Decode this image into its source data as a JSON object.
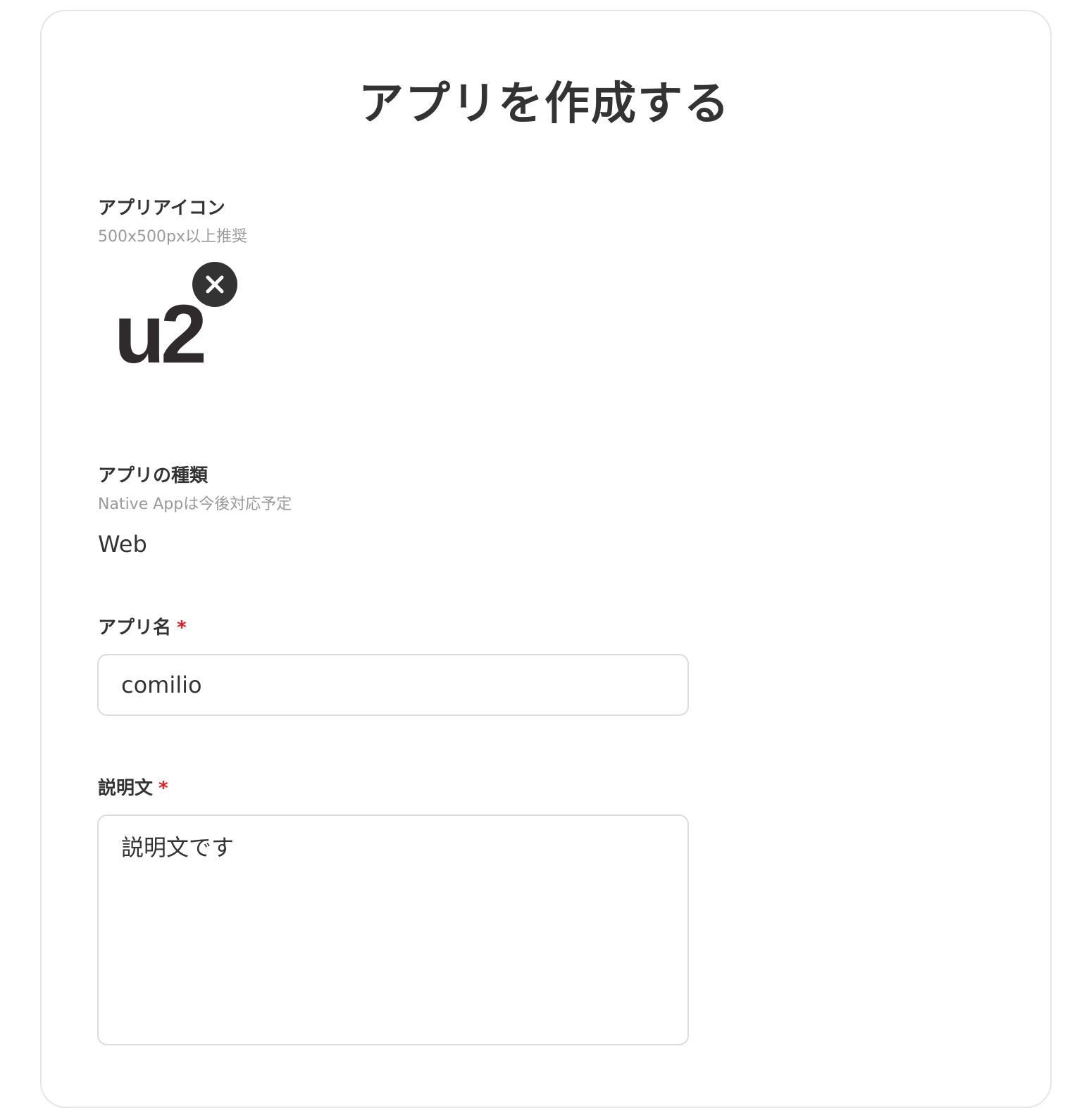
{
  "page": {
    "title": "アプリを作成する"
  },
  "icon_field": {
    "label": "アプリアイコン",
    "hint": "500x500px以上推奨",
    "preview_text": "u2",
    "remove_icon": "close-icon"
  },
  "type_field": {
    "label": "アプリの種類",
    "hint": "Native Appは今後対応予定",
    "value": "Web"
  },
  "name_field": {
    "label": "アプリ名",
    "required_mark": "*",
    "value": "comilio"
  },
  "description_field": {
    "label": "説明文",
    "required_mark": "*",
    "value": "説明文です"
  },
  "colors": {
    "text": "#333333",
    "hint": "#9a9a9a",
    "required": "#e02020",
    "border": "#dcdcdc"
  }
}
